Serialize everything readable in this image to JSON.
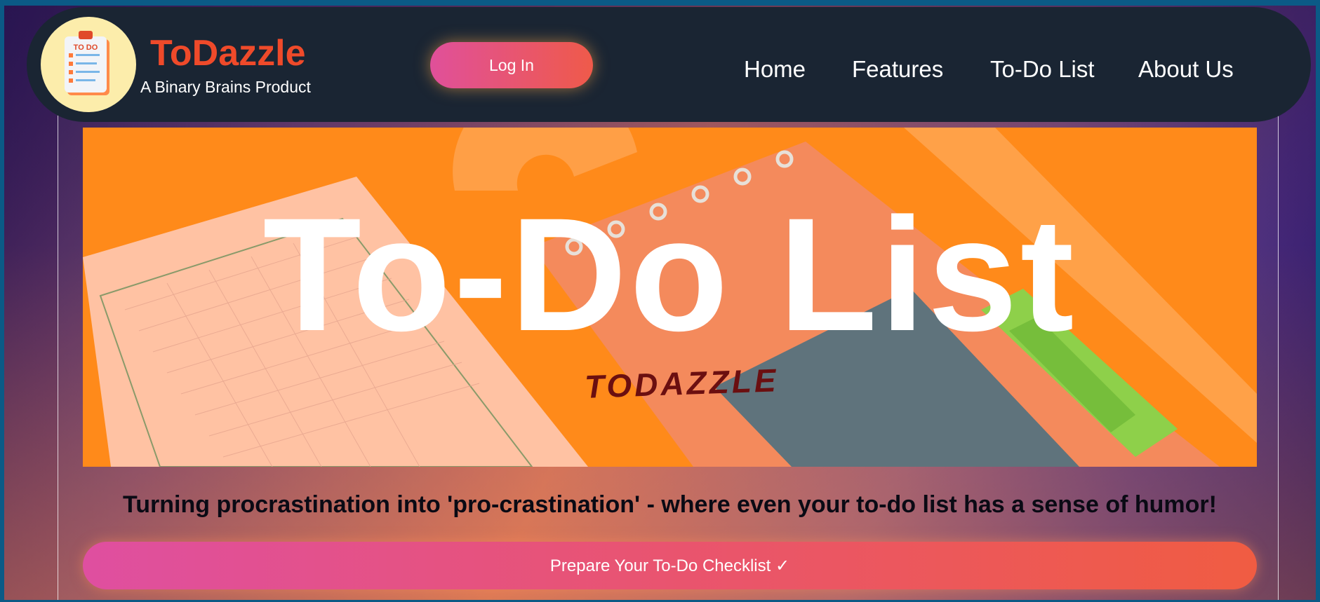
{
  "brand": {
    "name": "ToDazzle",
    "subtitle": "A Binary Brains Product",
    "logo_text": "TO DO",
    "logo_icon": "clipboard-todo-icon"
  },
  "header": {
    "login_label": "Log In",
    "nav": [
      "Home",
      "Features",
      "To-Do List",
      "About Us"
    ]
  },
  "hero": {
    "title": "To-Do List",
    "subtitle": "TODAZZLE"
  },
  "tagline": "Turning procrastination into 'pro-crastination' - where even your to-do list has a sense of humor!",
  "cta_label": "Prepare Your To-Do Checklist ✓",
  "colors": {
    "accent_orange": "#ef4a2a",
    "navbar_bg": "#1a2533",
    "hero_bg": "#ff8a1a",
    "button_gradient_start": "#df4fa0",
    "button_gradient_end": "#f05c42"
  }
}
